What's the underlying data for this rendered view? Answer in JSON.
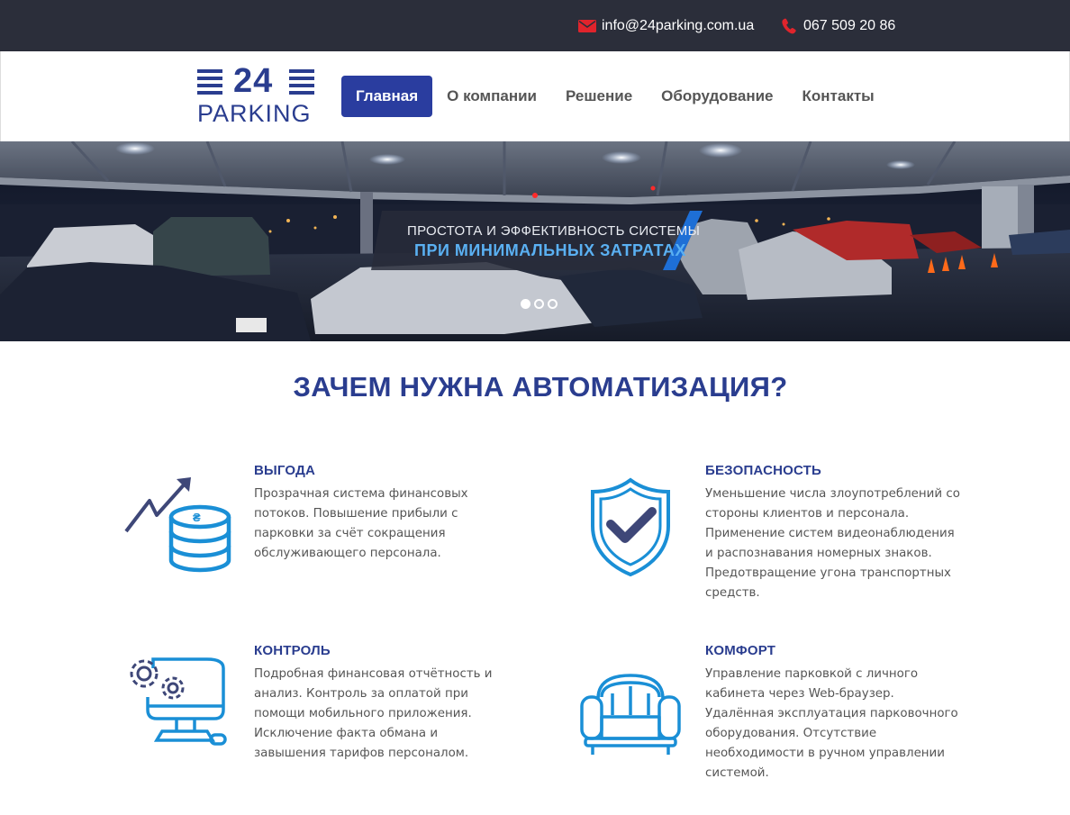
{
  "topbar": {
    "email": "info@24parking.com.ua",
    "phone": "067 509 20 86",
    "email_icon": "envelope-icon",
    "phone_icon": "phone-icon",
    "icon_color": "#e0242c"
  },
  "logo": {
    "number": "24",
    "word": "PARKING",
    "color": "#2a3d8f"
  },
  "nav": {
    "items": [
      {
        "label": "Главная",
        "active": true
      },
      {
        "label": "О компании",
        "active": false
      },
      {
        "label": "Решение",
        "active": false
      },
      {
        "label": "Оборудование",
        "active": false
      },
      {
        "label": "Контакты",
        "active": false
      }
    ],
    "active_color": "#2a3d9f"
  },
  "hero": {
    "line1": "ПРОСТОТА И ЭФФЕКТИВНОСТЬ СИСТЕМЫ",
    "line2": "ПРИ МИНИМАЛЬНЫХ ЗАТРАТАХ",
    "slides": 3,
    "active_slide": 1
  },
  "section": {
    "title": "ЗАЧЕМ НУЖНА АВТОМАТИЗАЦИЯ?"
  },
  "features": [
    {
      "title": "ВЫГОДА",
      "icon": "profit-chart-coins-icon",
      "lines": [
        "Прозрачная система финансовых",
        "потоков. Повышение прибыли с",
        "парковки за счёт сокращения",
        "обслуживающего персонала."
      ]
    },
    {
      "title": "БЕЗОПАСНОСТЬ",
      "icon": "shield-check-icon",
      "lines": [
        "Уменьшение числа злоупотреблений со",
        "стороны клиентов и персонала.",
        "Применение систем видеонаблюдения",
        "и распознавания номерных знаков.",
        "Предотвращение угона транспортных",
        "средств."
      ]
    },
    {
      "title": "КОНТРОЛЬ",
      "icon": "computer-gears-icon",
      "lines": [
        "Подробная финансовая отчётность и",
        "анализ. Контроль за оплатой при",
        "помощи мобильного приложения.",
        "Исключение факта обмана и",
        "завышения тарифов персоналом."
      ]
    },
    {
      "title": "КОМФОРТ",
      "icon": "armchair-icon",
      "lines": [
        "Управление парковкой с личного",
        "кабинета через Web-браузер.",
        "Удалённая эксплуатация парковочного",
        "оборудования. Отсутствие",
        "необходимости в ручном управлении",
        "системой."
      ]
    }
  ],
  "colors": {
    "accent_blue": "#2a3d8f",
    "icon_blue": "#1a8fd6",
    "topbar_bg": "#2b2e3a"
  }
}
